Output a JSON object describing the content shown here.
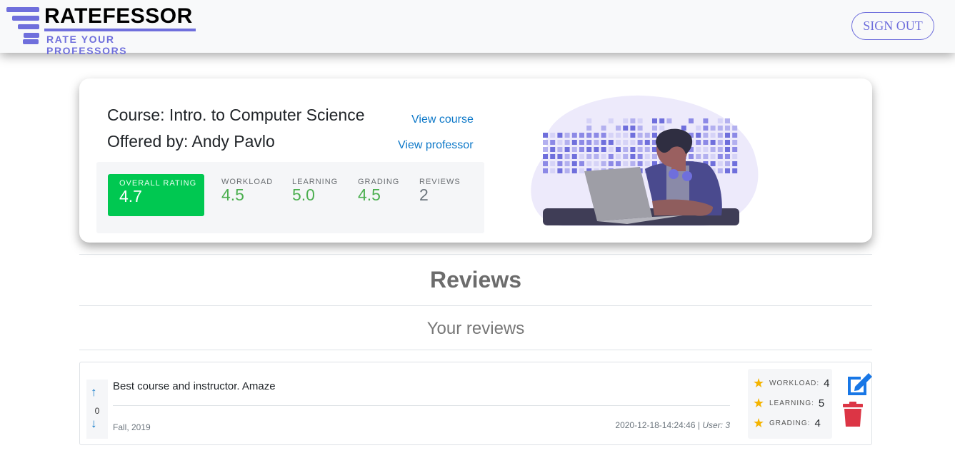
{
  "header": {
    "logo_title": "RATEFESSOR",
    "logo_subtitle": "RATE YOUR PROFESSORS",
    "sign_out_label": "SIGN OUT",
    "brand_color": "#6f6fdc"
  },
  "course": {
    "course_line": "Course: Intro. to Computer Science",
    "offered_line": "Offered by: Andy Pavlo",
    "view_course_label": "View course",
    "view_professor_label": "View professor",
    "stats": {
      "overall": {
        "label": "OVERALL RATING",
        "value": "4.7"
      },
      "workload": {
        "label": "WORKLOAD",
        "value": "4.5"
      },
      "learning": {
        "label": "LEARNING",
        "value": "5.0"
      },
      "grading": {
        "label": "GRADING",
        "value": "4.5"
      },
      "reviews": {
        "label": "REVIEWS",
        "value": "2"
      }
    },
    "colors": {
      "overall_bg": "#00c851",
      "good_value": "#4caf50",
      "neutral_value": "#6c757d"
    }
  },
  "sections": {
    "reviews_heading": "Reviews",
    "your_reviews_heading": "Your reviews"
  },
  "review": {
    "vote_count": "0",
    "text": "Best course and instructor. Amaze",
    "term": "Fall, 2019",
    "timestamp": "2020-12-18-14:24:46",
    "separator": "|",
    "user": "User: 3",
    "ratings": [
      {
        "label": "WORKLOAD:",
        "value": "4"
      },
      {
        "label": "LEARNING:",
        "value": "5"
      },
      {
        "label": "GRADING:",
        "value": "4"
      }
    ],
    "icons": {
      "upvote": "arrow-up-icon",
      "downvote": "arrow-down-icon",
      "star": "star-icon",
      "edit": "edit-icon",
      "delete": "trash-icon"
    },
    "colors": {
      "edit": "#1877e6",
      "delete": "#dc3545",
      "star": "#f4b400"
    }
  }
}
